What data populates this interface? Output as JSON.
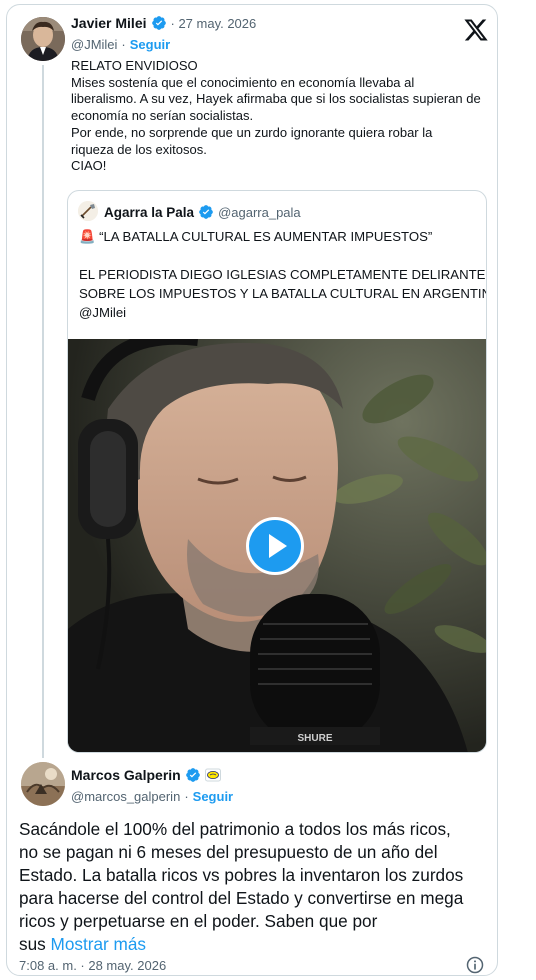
{
  "main_tweet": {
    "author_name": "Javier Milei",
    "date": "· 27 may. 2026",
    "handle": "@JMilei",
    "separator": "·",
    "follow_label": "Seguir",
    "text_lines": [
      "RELATO ENVIDIOSO",
      "Mises sostenía que el conocimiento en economía llevaba al",
      "liberalismo. A su vez, Hayek afirmaba que si los socialistas supieran de",
      "economía no serían socialistas.",
      "Por ende, no sorprende que un zurdo ignorante quiera robar la",
      "riqueza de los exitosos.",
      "CIAO!"
    ]
  },
  "quoted_tweet": {
    "author_name": "Agarra la Pala",
    "handle": "@agarra_pala",
    "headline": "🚨 “LA BATALLA CULTURAL ES AUMENTAR IMPUESTOS”",
    "body_lines": [
      "EL PERIODISTA DIEGO IGLESIAS COMPLETAMENTE DELIRANTE",
      "SOBRE LOS IMPUESTOS Y LA BATALLA CULTURAL EN ARGENTINA",
      "@JMilei"
    ],
    "microphone_brand": "SHURE"
  },
  "reply_tweet": {
    "author_name": "Marcos Galperin",
    "handle": "@marcos_galperin",
    "separator": "·",
    "follow_label": "Seguir",
    "text_lines": [
      "Sacándole el 100% del patrimonio a todos los más ricos,",
      "no se pagan ni 6 meses del presupuesto de un año del",
      "Estado. La batalla ricos vs pobres la inventaron los zurdos",
      "para hacerse del control del Estado y convertirse en mega",
      "ricos y perpetuarse en el poder. Saben que por"
    ],
    "last_line_start": "sus ",
    "show_more_label": "Mostrar más",
    "timestamp": "7:08 a. m. · 28 may. 2026"
  },
  "icons": {
    "platform_logo": "x-logo-icon",
    "verified": "verified-badge-icon",
    "affiliate": "company-badge-icon",
    "play": "play-icon",
    "info": "info-icon"
  },
  "colors": {
    "accent": "#1d9bf0",
    "text": "#0f1419",
    "muted": "#536471",
    "border": "#cfd9de"
  }
}
